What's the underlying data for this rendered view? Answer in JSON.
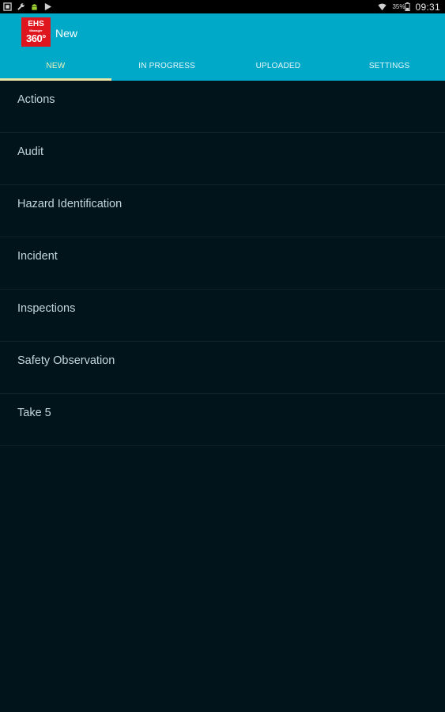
{
  "status_bar": {
    "icons": [
      "screenshot-icon",
      "wrench-icon",
      "android-icon",
      "play-icon",
      "wifi-icon",
      "battery-icon"
    ],
    "battery_percent": "35%",
    "time": "09:31"
  },
  "app_bar": {
    "logo": {
      "line1": "EHS",
      "line2": "Manager",
      "line3": "360°"
    },
    "title": "New",
    "background_color": "#00a9c8"
  },
  "tabs": [
    {
      "label": "NEW",
      "active": true
    },
    {
      "label": "IN PROGRESS",
      "active": false
    },
    {
      "label": "UPLOADED",
      "active": false
    },
    {
      "label": "SETTINGS",
      "active": false
    }
  ],
  "list": {
    "items": [
      {
        "label": "Actions"
      },
      {
        "label": "Audit"
      },
      {
        "label": "Hazard Identification"
      },
      {
        "label": "Incident"
      },
      {
        "label": "Inspections"
      },
      {
        "label": "Safety Observation"
      },
      {
        "label": "Take 5"
      }
    ]
  },
  "colors": {
    "background": "#02141b",
    "accent": "#00a9c8",
    "tab_indicator": "#e9e6a8",
    "logo_red": "#e0161f"
  }
}
